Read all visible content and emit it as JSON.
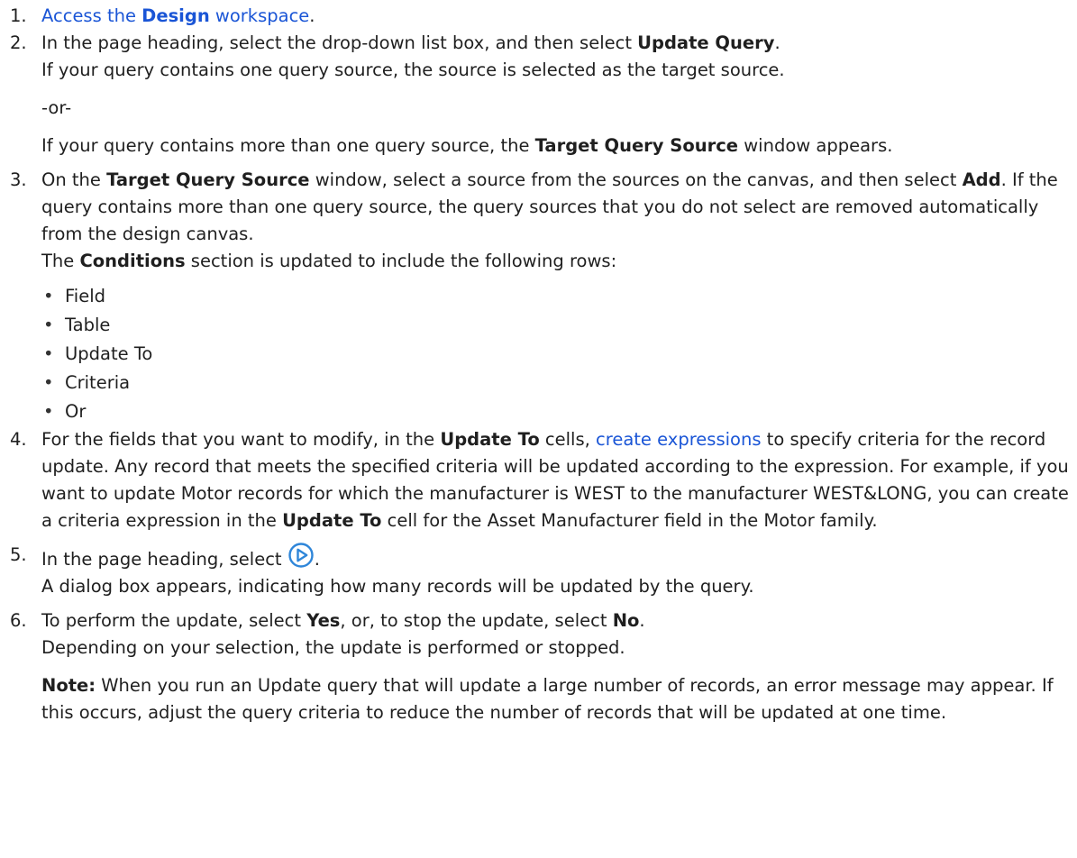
{
  "step1": {
    "number": "1.",
    "link_pre": "Access the ",
    "link_bold": "Design",
    "link_post": " workspace",
    "end": "."
  },
  "step2": {
    "number": "2.",
    "line1_pre": "In the page heading, select the drop-down list box, and then select ",
    "line1_bold": "Update Query",
    "line1_end": ".",
    "line2": "If your query contains one query source, the source is selected as the target source.",
    "or": "-or-",
    "line3_pre": "If your query contains more than one query source, the ",
    "line3_bold": "Target Query Source",
    "line3_end": " window appears."
  },
  "step3": {
    "number": "3.",
    "t1": "On the ",
    "b1": "Target Query Source",
    "t2": " window, select a source from the sources on the canvas, and then select ",
    "b2": "Add",
    "t3": ". If the query contains more than one query source, the query sources that you do not select are removed automatically from the design canvas.",
    "t4": "The ",
    "b3": "Conditions",
    "t5": " section is updated to include the following rows:",
    "rows": [
      "Field",
      "Table",
      "Update To",
      "Criteria",
      "Or"
    ]
  },
  "step4": {
    "number": "4.",
    "t1": "For the fields that you want to modify, in the ",
    "b1": "Update To",
    "t2": " cells, ",
    "link": "create expressions",
    "t3": " to specify criteria for the record update. Any record that meets the specified criteria will be updated according to the expression. For example, if you want to update Motor records for which the manufacturer is WEST to the manufacturer WEST&LONG, you can create a criteria expression in the ",
    "b2": "Update To",
    "t4": " cell for the Asset Manufacturer field in the Motor family."
  },
  "step5": {
    "number": "5.",
    "t1": "In the page heading, select ",
    "icon": "run-query-icon",
    "t2": ".",
    "line2": "A dialog box appears, indicating how many records will be updated by the query."
  },
  "step6": {
    "number": "6.",
    "t1": "To perform the update, select ",
    "b1": "Yes",
    "t2": ", or, to stop the update, select ",
    "b2": "No",
    "t3": ".",
    "line2": "Depending on your selection, the update is performed or stopped.",
    "note_label": "Note:",
    "note_text": " When you run an Update query that will update a large number of records, an error message may appear. If this occurs, adjust the query criteria to reduce the number of records that will be updated at one time."
  },
  "colors": {
    "link": "#1a55d6",
    "icon": "#2f86d9",
    "text": "#1f1f1f"
  }
}
